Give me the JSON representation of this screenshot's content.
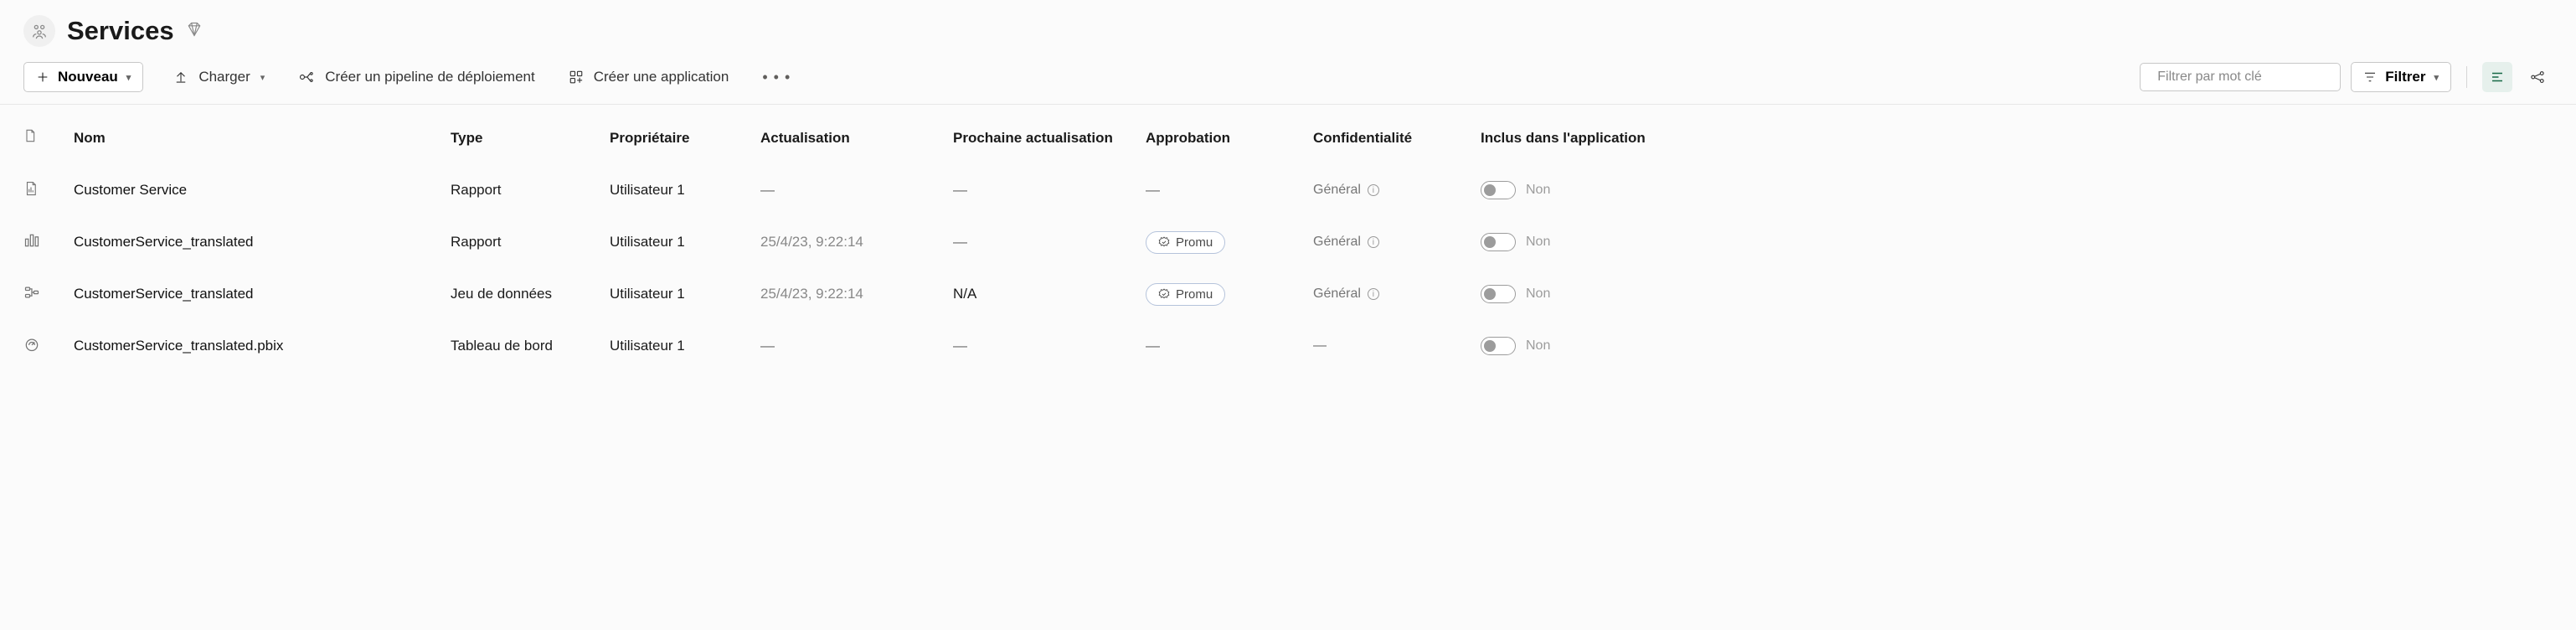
{
  "header": {
    "title": "Services"
  },
  "toolbar": {
    "nouveau": "Nouveau",
    "charger": "Charger",
    "pipeline": "Créer un pipeline de déploiement",
    "app": "Créer une application",
    "searchPlaceholder": "Filtrer par mot clé",
    "filter": "Filtrer"
  },
  "columns": {
    "name": "Nom",
    "type": "Type",
    "owner": "Propriétaire",
    "refresh": "Actualisation",
    "nextRefresh": "Prochaine actualisation",
    "endorsement": "Approbation",
    "sensitivity": "Confidentialité",
    "includedInApp": "Inclus dans l'application"
  },
  "rows": [
    {
      "icon": "report",
      "name": "Customer Service",
      "type": "Rapport",
      "owner": "Utilisateur 1",
      "refresh": "—",
      "nextRefresh": "—",
      "endorsement": "—",
      "sensitivity": "Général",
      "included": "Non"
    },
    {
      "icon": "report-bar",
      "name": "CustomerService_translated",
      "type": "Rapport",
      "owner": "Utilisateur 1",
      "refresh": "25/4/23, 9:22:14",
      "nextRefresh": "—",
      "endorsement": "Promu",
      "sensitivity": "Général",
      "included": "Non"
    },
    {
      "icon": "dataset",
      "name": "CustomerService_translated",
      "type": "Jeu de données",
      "owner": "Utilisateur 1",
      "refresh": "25/4/23, 9:22:14",
      "nextRefresh": "N/A",
      "endorsement": "Promu",
      "sensitivity": "Général",
      "included": "Non"
    },
    {
      "icon": "dashboard",
      "name": "CustomerService_translated.pbix",
      "type": "Tableau de bord",
      "owner": "Utilisateur 1",
      "refresh": "—",
      "nextRefresh": "—",
      "endorsement": "—",
      "sensitivity": "—",
      "included": "Non"
    }
  ]
}
